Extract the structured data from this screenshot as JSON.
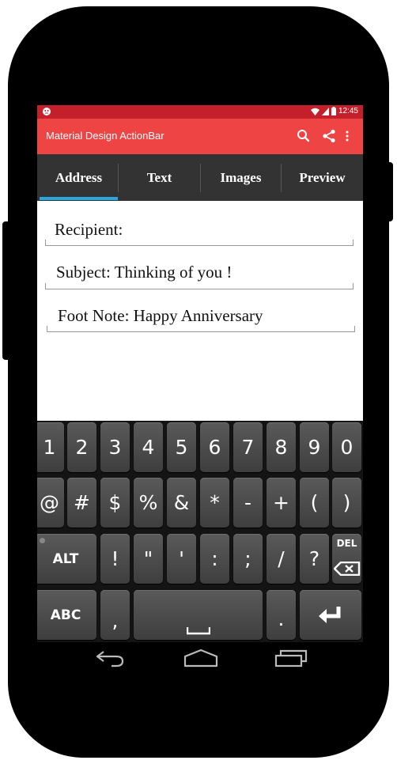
{
  "colors": {
    "status_bar": "#c4202b",
    "action_bar": "#ef4444",
    "tab_bar": "#333333",
    "tab_indicator": "#29a8e0"
  },
  "status_bar": {
    "notification_icon": "android-icon",
    "time": "12:45",
    "icons": [
      "wifi-icon",
      "signal-icon",
      "battery-icon"
    ]
  },
  "action_bar": {
    "title": "Material Design ActionBar",
    "icons": [
      "search-icon",
      "share-icon",
      "overflow-menu-icon"
    ]
  },
  "tabs": [
    {
      "label": "Address",
      "selected": true
    },
    {
      "label": "Text",
      "selected": false
    },
    {
      "label": "Images",
      "selected": false
    },
    {
      "label": "Preview",
      "selected": false
    }
  ],
  "form": {
    "recipient": "Recipient:",
    "subject": "Subject: Thinking of you !",
    "footnote": "Foot Note: Happy Anniversary"
  },
  "keyboard": {
    "row1": [
      "1",
      "2",
      "3",
      "4",
      "5",
      "6",
      "7",
      "8",
      "9",
      "0"
    ],
    "row2": [
      "@",
      "#",
      "$",
      "%",
      "&",
      "*",
      "-",
      "+",
      "(",
      ")"
    ],
    "row3": {
      "alt": "ALT",
      "keys": [
        "!",
        "\"",
        "'",
        ":",
        ";",
        "/",
        "?"
      ],
      "del": "DEL"
    },
    "row4": {
      "abc": "ABC",
      "comma": ",",
      "space": "␣",
      "period": ".",
      "enter_icon": "enter-icon"
    }
  },
  "nav_bar": {
    "icons": [
      "back-icon",
      "home-icon",
      "recents-icon"
    ]
  }
}
